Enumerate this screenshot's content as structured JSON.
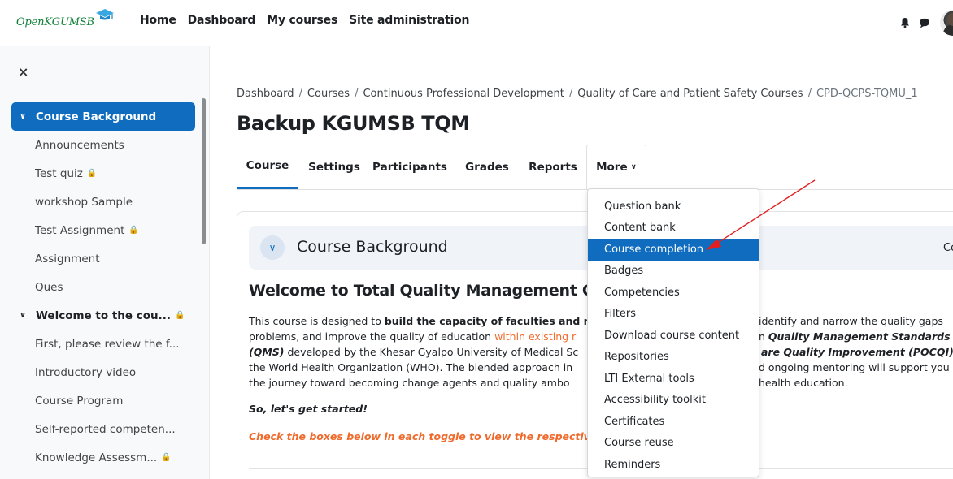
{
  "navbar": {
    "logo_text": "OpenKGUMSB",
    "links": [
      "Home",
      "Dashboard",
      "My courses",
      "Site administration"
    ]
  },
  "drawer": {
    "close_label": "×",
    "items": [
      {
        "label": "Course Background",
        "type": "section",
        "active": true
      },
      {
        "label": "Announcements",
        "type": "item"
      },
      {
        "label": "Test quiz",
        "type": "item",
        "locked": true
      },
      {
        "label": "workshop Sample",
        "type": "item"
      },
      {
        "label": "Test Assignment",
        "type": "item",
        "locked": true
      },
      {
        "label": "Assignment",
        "type": "item"
      },
      {
        "label": "Ques",
        "type": "item"
      },
      {
        "label": "Welcome to the cou...",
        "type": "section",
        "locked": true
      },
      {
        "label": "First, please review the f...",
        "type": "item"
      },
      {
        "label": "Introductory video",
        "type": "item"
      },
      {
        "label": "Course Program",
        "type": "item"
      },
      {
        "label": "Self-reported competen...",
        "type": "item"
      },
      {
        "label": "Knowledge Assessm...",
        "type": "item",
        "locked": true
      }
    ]
  },
  "breadcrumb": [
    "Dashboard",
    "Courses",
    "Continuous Professional Development",
    "Quality of Care and Patient Safety Courses",
    "CPD-QCPS-TQMU_1"
  ],
  "page_title": "Backup KGUMSB TQM",
  "tabs": [
    "Course",
    "Settings",
    "Participants",
    "Grades",
    "Reports",
    "More"
  ],
  "section": {
    "title": "Course Background",
    "right_text": "Co"
  },
  "content": {
    "heading": "Welcome to Total Quality Management C",
    "line1": {
      "a": "This course is designed to ",
      "b": "build the capacity of faculties and n",
      "c": "identify and narrow the quality gaps"
    },
    "line2": {
      "a": "problems, and improve the quality of education ",
      "b": "within existing r",
      "c": "n ",
      "d": "Quality Management Standards"
    },
    "line3": {
      "a": "(QMS)",
      "b": " developed by the Khesar Gyalpo University of Medical Sc",
      "c": "are Quality Improvement (POCQI)",
      "d": " d"
    },
    "line4": {
      "a": "the World Health Organization (WHO). The blended approach in",
      "b": "d ongoing mentoring will support you"
    },
    "line5": {
      "a": "the journey toward becoming change agents and quality ambo",
      "b": "health education."
    },
    "started": "So, let's get started!",
    "check": "Check the boxes below in each toggle to view the respective c"
  },
  "more_menu": {
    "items": [
      "Question bank",
      "Content bank",
      "Course completion",
      "Badges",
      "Competencies",
      "Filters",
      "Download course content",
      "Repositories",
      "LTI External tools",
      "Accessibility toolkit",
      "Certificates",
      "Course reuse",
      "Reminders"
    ],
    "highlighted": "Course completion"
  },
  "colors": {
    "primary": "#0f6cbf",
    "accent_orange": "#f06a2c",
    "logo_green": "#13803a",
    "annotation_arrow": "#e0201f"
  }
}
